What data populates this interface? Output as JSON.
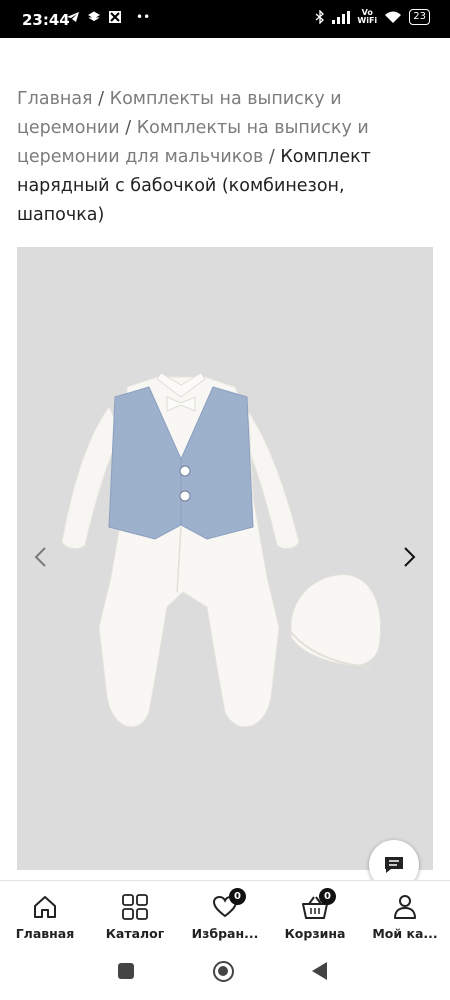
{
  "status_bar": {
    "time": "23:44",
    "signal_text": "Vo WiFi",
    "battery": "23"
  },
  "breadcrumb": {
    "items": [
      "Главная",
      "Комплекты на выписку и церемонии",
      "Комплекты на выписку и церемонии для мальчиков"
    ],
    "separator": "/",
    "current": "Комплект нарядный с бабочкой (комбинезон, шапочка)"
  },
  "gallery": {
    "prev_icon": "chevron-left-icon",
    "next_icon": "chevron-right-icon"
  },
  "chat": {
    "icon": "chat-icon"
  },
  "bottom_nav": {
    "items": [
      {
        "label": "Главная",
        "icon": "home-icon"
      },
      {
        "label": "Каталог",
        "icon": "grid-icon"
      },
      {
        "label": "Избран...",
        "icon": "heart-icon",
        "badge": "0"
      },
      {
        "label": "Корзина",
        "icon": "basket-icon",
        "badge": "0"
      },
      {
        "label": "Мой ка...",
        "icon": "user-icon"
      }
    ]
  },
  "colors": {
    "gallery_bg": "#dcdcdc",
    "breadcrumb_link": "#7c7c7c",
    "text": "#222222",
    "vest_blue": "#9db0cc"
  }
}
